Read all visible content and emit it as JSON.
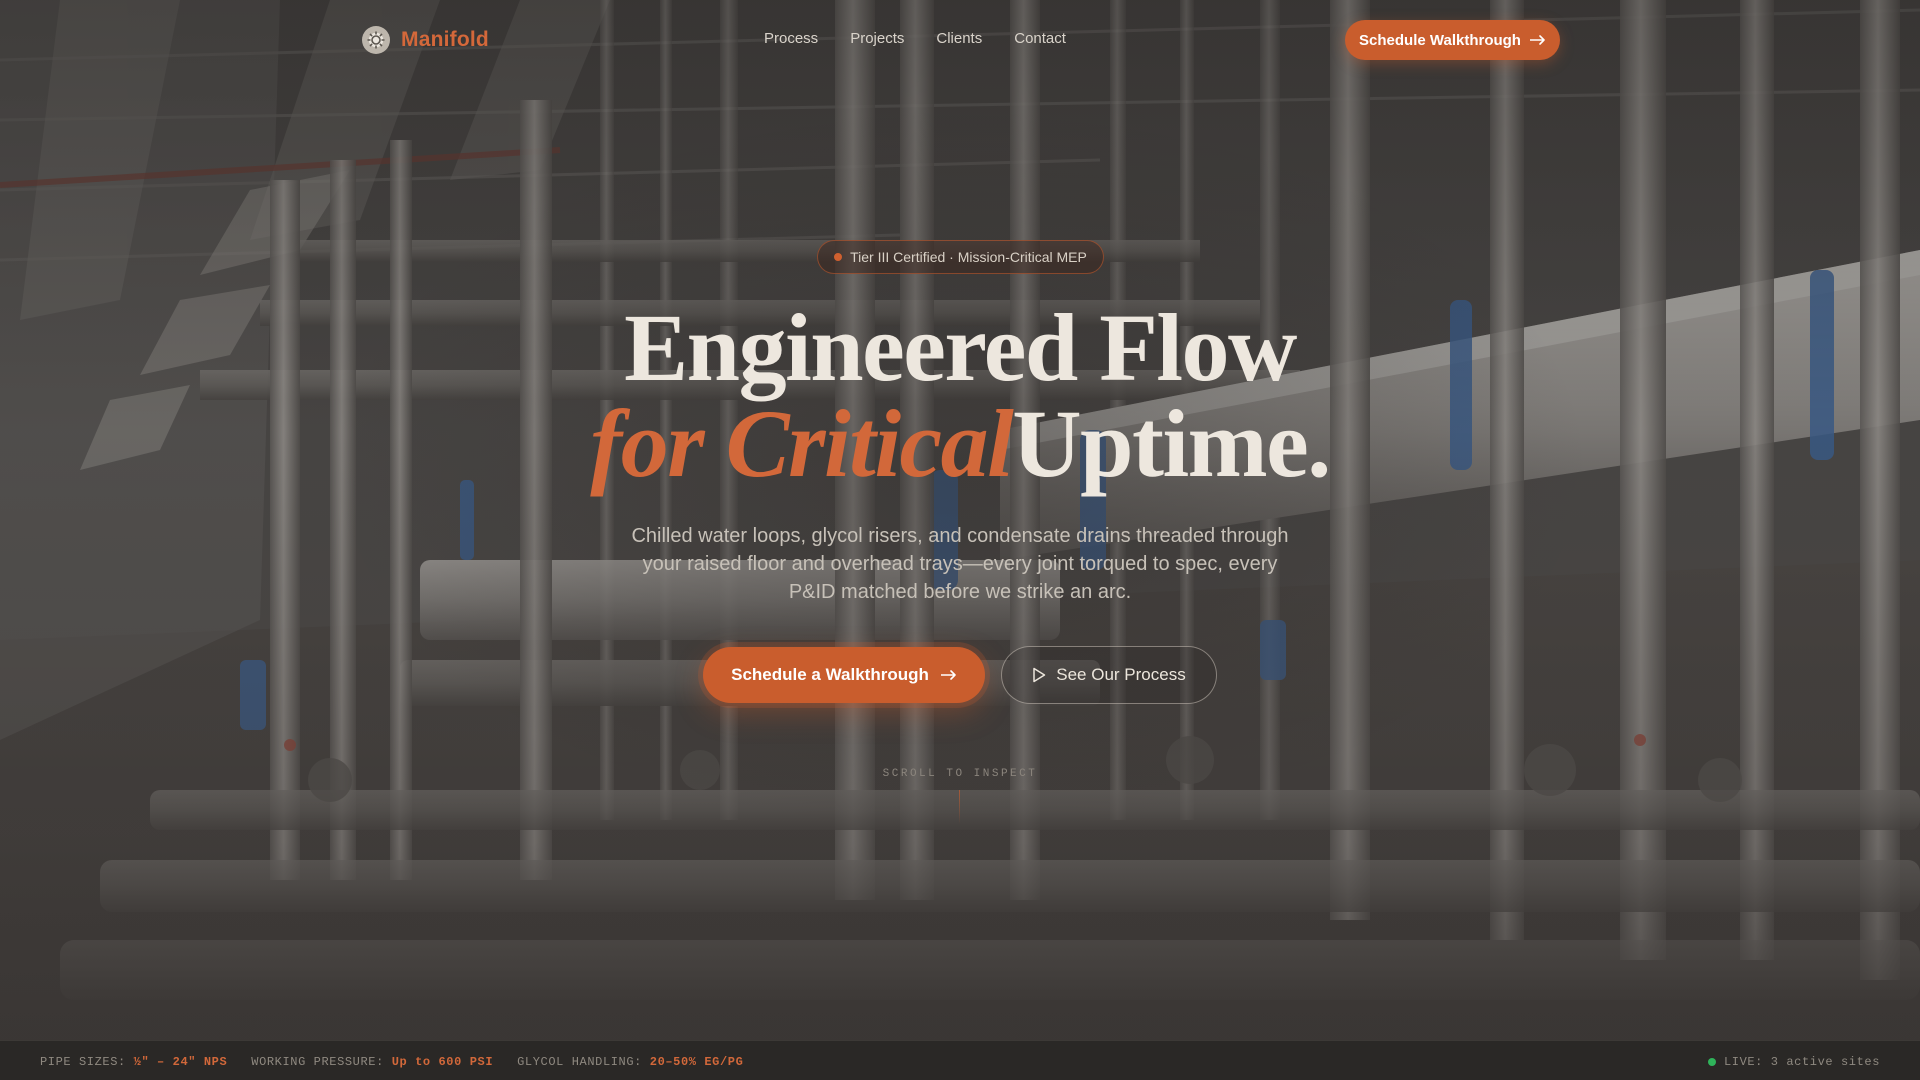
{
  "brand": {
    "name": "Manifold",
    "icon": "gear-logo-icon"
  },
  "nav": {
    "items": [
      {
        "label": "Process"
      },
      {
        "label": "Projects"
      },
      {
        "label": "Clients"
      },
      {
        "label": "Contact"
      }
    ]
  },
  "header": {
    "cta_label": "Schedule Walkthrough",
    "cta_icon": "arrow-right-icon"
  },
  "hero": {
    "badge": "Tier III Certified · Mission-Critical MEP",
    "headline_line1": "Engineered Flow",
    "headline_accent": "for Critical",
    "headline_rest": "Uptime.",
    "subtext": "Chilled water loops, glycol risers, and condensate drains threaded through your raised floor and overhead trays—every joint torqued to spec, every P&ID matched before we strike an arc.",
    "primary_cta": "Schedule a Walkthrough",
    "secondary_cta": "See Our Process",
    "secondary_icon": "play-icon",
    "scroll_hint": "SCROLL TO INSPECT"
  },
  "specs": {
    "items": [
      {
        "label": "PIPE SIZES:",
        "value": "½\" – 24\" NPS"
      },
      {
        "label": "WORKING PRESSURE:",
        "value": "Up to 600 PSI"
      },
      {
        "label": "GLYCOL HANDLING:",
        "value": "20–50% EG/PG"
      }
    ],
    "live": "LIVE: 3 active sites"
  },
  "colors": {
    "accent": "#c95d2d",
    "accent_text": "#d2683a",
    "live": "#2fb35a",
    "background": "#3a3836"
  }
}
